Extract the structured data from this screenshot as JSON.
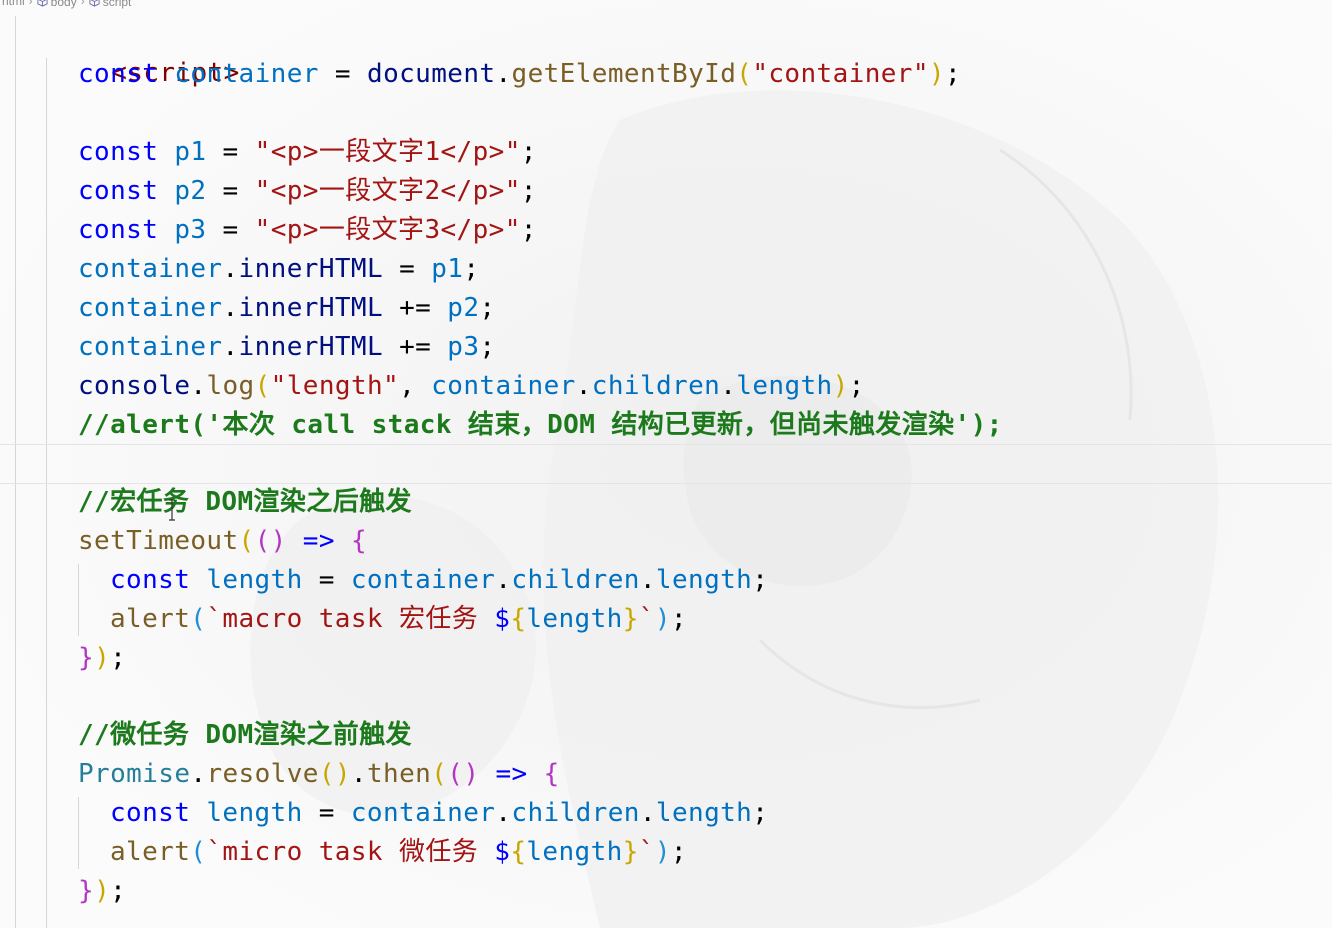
{
  "breadcrumb": [
    "html",
    "body",
    "script"
  ],
  "code": {
    "script_open": "<script>",
    "line1": {
      "kw": "const",
      "name": "container",
      "eq": "=",
      "obj": "document",
      "fn": "getElementById",
      "arg": "\"container\"",
      "end": ";"
    },
    "p_lines": [
      {
        "kw": "const",
        "name": "p1",
        "eq": "=",
        "str": "\"<p>一段文字1</p>\"",
        "end": ";"
      },
      {
        "kw": "const",
        "name": "p2",
        "eq": "=",
        "str": "\"<p>一段文字2</p>\"",
        "end": ";"
      },
      {
        "kw": "const",
        "name": "p3",
        "eq": "=",
        "str": "\"<p>一段文字3</p>\"",
        "end": ";"
      }
    ],
    "inner_lines": [
      {
        "obj": "container",
        "prop": "innerHTML",
        "op": "=",
        "val": "p1",
        "end": ";"
      },
      {
        "obj": "container",
        "prop": "innerHTML",
        "op": "+=",
        "val": "p2",
        "end": ";"
      },
      {
        "obj": "container",
        "prop": "innerHTML",
        "op": "+=",
        "val": "p3",
        "end": ";"
      }
    ],
    "console_line": {
      "obj": "console",
      "fn": "log",
      "str": "\"length\"",
      "comma": ",",
      "a": "container",
      "b": "children",
      "c": "length",
      "end": ";"
    },
    "alert_comment": "//alert('本次 call stack 结束，DOM 结构已更新，但尚未触发渲染');",
    "macro_comment": "//宏任务 DOM渲染之后触发",
    "set_timeout": "setTimeout",
    "arrow": "=>",
    "const_kw": "const",
    "length_name": "length",
    "children_expr": {
      "a": "container",
      "b": "children",
      "c": "length"
    },
    "alert_fn": "alert",
    "macro_tpl": "`macro task 宏任务 ",
    "micro_tpl": "`micro task 微任务 ",
    "tpl_dollar": "$",
    "tpl_var": "length",
    "tpl_end": "`",
    "micro_comment": "//微任务 DOM渲染之前触发",
    "promise": "Promise",
    "resolve": "resolve",
    "then": "then",
    "close": "});"
  }
}
